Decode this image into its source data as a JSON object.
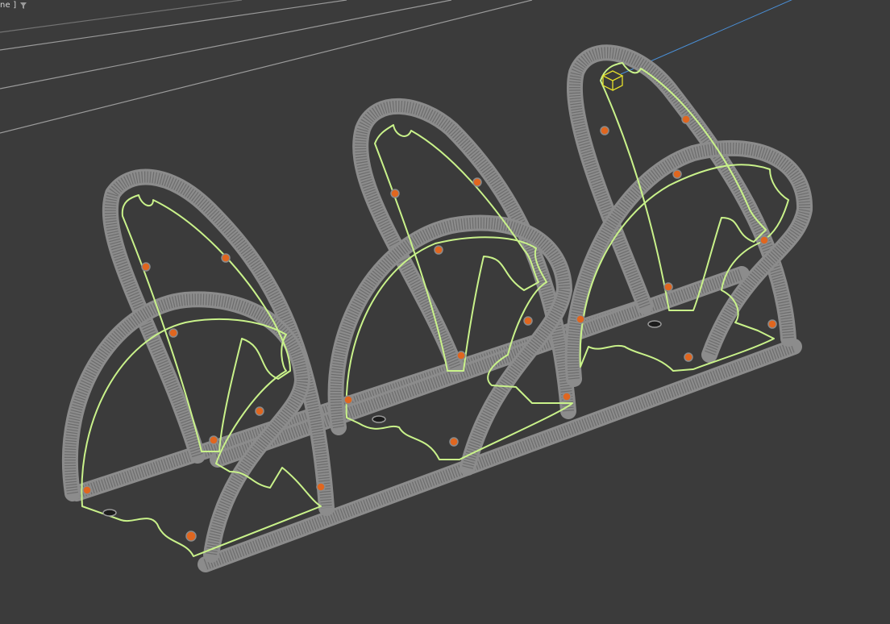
{
  "viewport": {
    "label": "ne ]",
    "filter_icon": "funnel-icon",
    "background_color": "#3b3b3b"
  },
  "scene": {
    "object_description_colors": {
      "tube": "#8c8c8c",
      "outline_selected": "#c9f28a",
      "bolt": "#e0661f",
      "axis": "#4a8fd6",
      "pivot_gizmo": "#e6e02a"
    },
    "icons": [
      "pivot-gizmo-icon"
    ]
  }
}
